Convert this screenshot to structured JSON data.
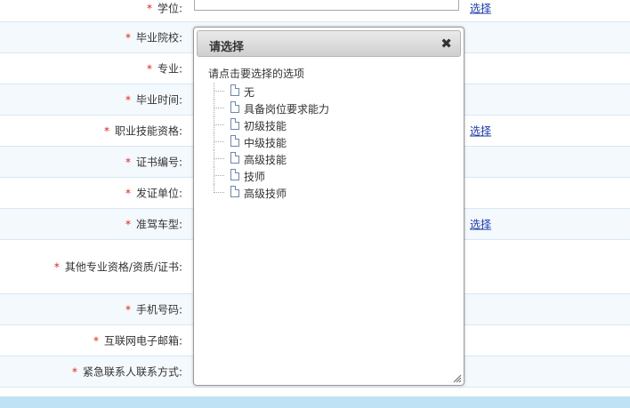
{
  "form": {
    "rows": [
      {
        "label": "学位:",
        "link": "选择"
      },
      {
        "label": "毕业院校:"
      },
      {
        "label": "专业:"
      },
      {
        "label": "毕业时间:"
      },
      {
        "label": "职业技能资格:",
        "link": "选择"
      },
      {
        "label": "证书编号:"
      },
      {
        "label": "发证单位:"
      },
      {
        "label": "准驾车型:",
        "link": "选择"
      },
      {
        "label": "其他专业资格/资质/证书:"
      },
      {
        "label": "手机号码:"
      },
      {
        "label": "互联网电子邮箱:"
      },
      {
        "label": "紧急联系人联系方式:"
      }
    ],
    "required_mark": "*"
  },
  "dialog": {
    "title": "请选择",
    "close_glyph": "✖",
    "hint": "请点击要选择的选项",
    "options": [
      "无",
      "具备岗位要求能力",
      "初级技能",
      "中级技能",
      "高级技能",
      "技师",
      "高级技师"
    ]
  }
}
